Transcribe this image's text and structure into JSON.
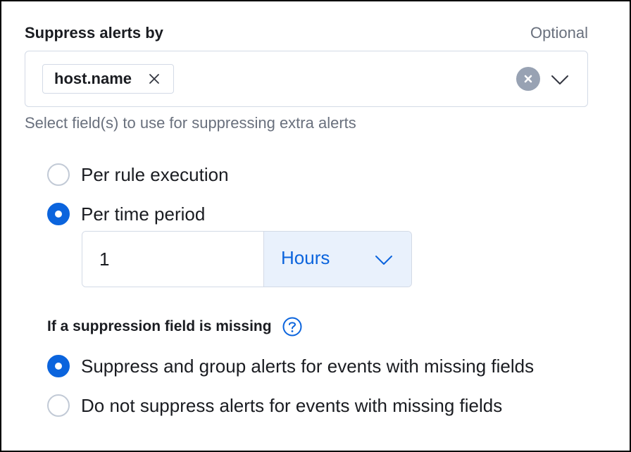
{
  "suppress": {
    "label": "Suppress alerts by",
    "optional": "Optional",
    "selected_fields": [
      "host.name"
    ],
    "help_text": "Select field(s) to use for suppressing extra alerts"
  },
  "duration_options": {
    "selected": "per_time_period",
    "per_rule_execution": "Per rule execution",
    "per_time_period": "Per time period",
    "time_value": "1",
    "time_unit": "Hours"
  },
  "missing_fields": {
    "label": "If a suppression field is missing",
    "selected": "suppress_and_group",
    "suppress_and_group": "Suppress and group alerts for events with missing fields",
    "do_not_suppress": "Do not suppress alerts for events with missing fields"
  },
  "colors": {
    "accent": "#0b64dd",
    "text": "#1a1c21",
    "subdued": "#69707d",
    "border": "#d3dae6",
    "select_bg": "#e9f1fc"
  }
}
